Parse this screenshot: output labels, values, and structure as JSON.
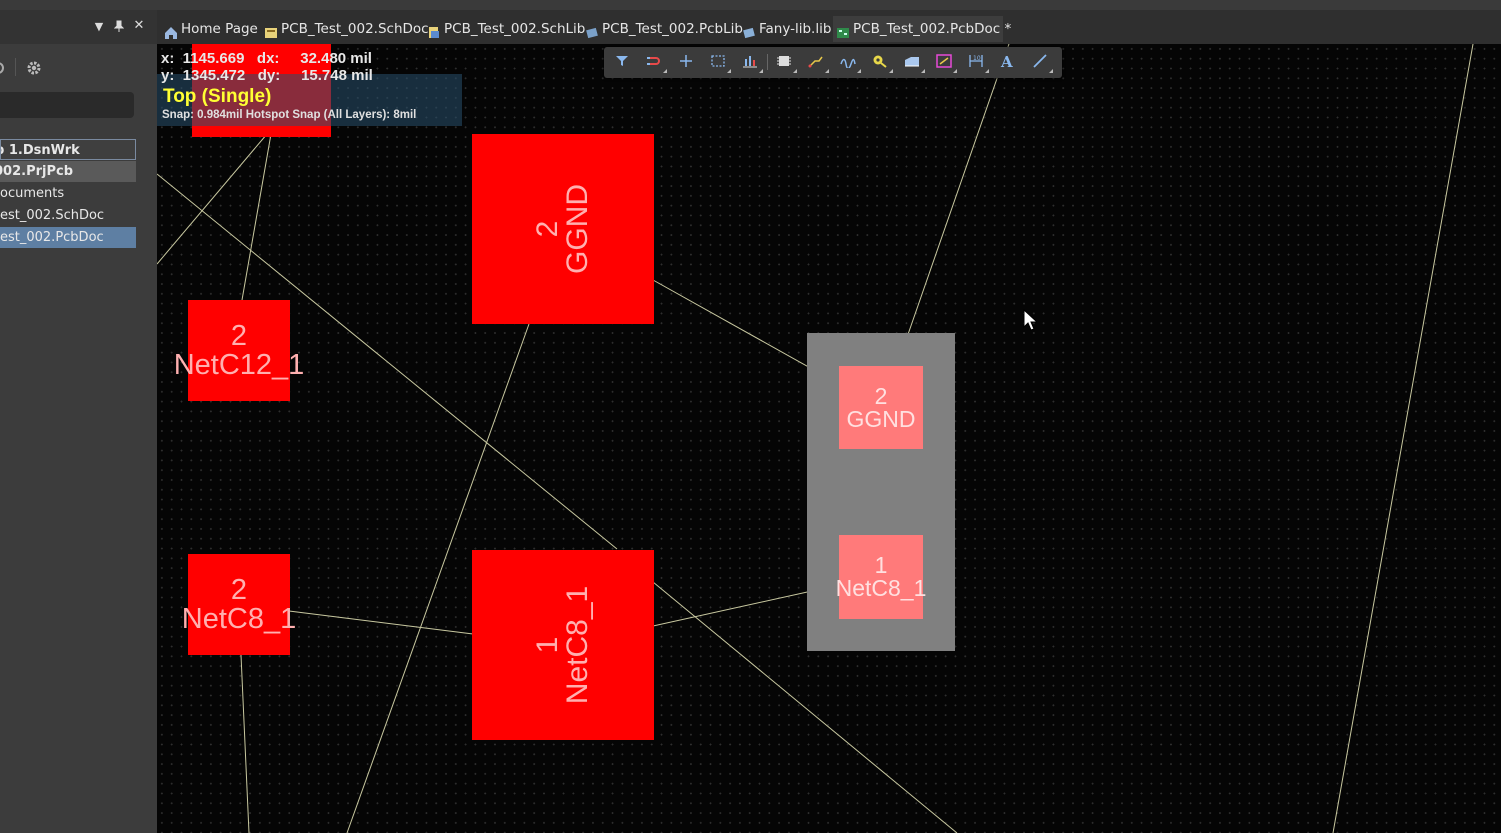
{
  "tabs": [
    {
      "label": "Home Page",
      "icon": "home-icon",
      "active": false
    },
    {
      "label": "PCB_Test_002.SchDoc",
      "icon": "schematic-doc-icon",
      "active": false
    },
    {
      "label": "PCB_Test_002.SchLib",
      "icon": "schematic-lib-icon",
      "active": false
    },
    {
      "label": "PCB_Test_002.PcbLib",
      "icon": "pcb-lib-icon",
      "active": false
    },
    {
      "label": "Fany-lib.lib",
      "icon": "integrated-lib-icon",
      "active": false
    },
    {
      "label": "PCB_Test_002.PcbDoc *",
      "icon": "pcb-doc-icon",
      "active": true
    }
  ],
  "panel": {
    "tree": [
      {
        "label": "p 1.DsnWrk"
      },
      {
        "label": "002.PrjPcb"
      },
      {
        "label": "ocuments"
      },
      {
        "label": "est_002.SchDoc"
      },
      {
        "label": "est_002.PcbDoc"
      }
    ]
  },
  "hud": {
    "line1": "x:  1145.669   dx:     32.480 mil",
    "line2": "y:  1345.472   dy:     15.748 mil",
    "layer": "Top (Single)",
    "snap": "Snap: 0.984mil Hotspot Snap (All Layers): 8mil"
  },
  "pads": [
    {
      "id": "pad-c12-2",
      "num": "2",
      "net": "NetC12_1"
    },
    {
      "id": "pad-u-ggnd",
      "num": "2",
      "net": "GGND"
    },
    {
      "id": "pad-c8-2",
      "num": "2",
      "net": "NetC8_1"
    },
    {
      "id": "pad-u-netc8",
      "num": "1",
      "net": "NetC8_1"
    },
    {
      "id": "pad-sel-ggnd",
      "num": "2",
      "net": "GGND"
    },
    {
      "id": "pad-sel-netc8",
      "num": "1",
      "net": "NetC8_1"
    }
  ],
  "toolbar": [
    "filter-icon",
    "route-icon",
    "place-cross-icon",
    "select-rect-icon",
    "align-icon",
    "component-icon",
    "interactive-route-icon",
    "differential-pair-icon",
    "via-pad-icon",
    "polygon-icon",
    "keepout-icon",
    "dimension-icon",
    "text-icon",
    "line-icon"
  ],
  "colors": {
    "pad": "#ff0000",
    "pad_selected": "#ff7a7a",
    "selection": "#808080",
    "ratsnest": "#c8c8a0",
    "layer_text": "#ffff33"
  }
}
